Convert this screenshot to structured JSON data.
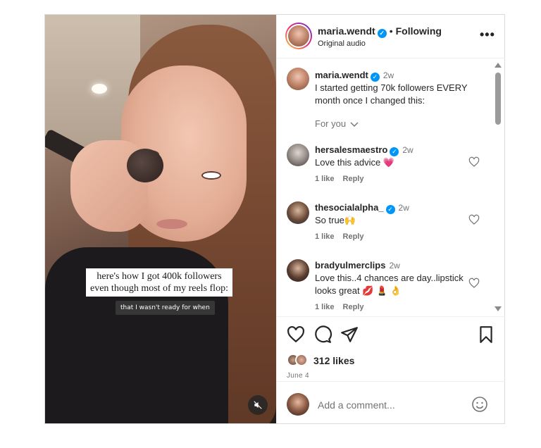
{
  "media": {
    "caption_lines": [
      "here's how I got 400k followers",
      "even though most of my reels flop:"
    ],
    "subtitle": "that I wasn't ready for when",
    "mute_icon": "mute-icon"
  },
  "header": {
    "username": "maria.wendt",
    "separator": "•",
    "follow_status": "Following",
    "audio": "Original audio",
    "more_icon": "more-options-icon"
  },
  "caption": {
    "username": "maria.wendt",
    "time": "2w",
    "text": "I started getting 70k followers EVERY month once I changed this:",
    "for_you": "For you"
  },
  "comments": [
    {
      "username": "hersalesmaestro",
      "verified": true,
      "time": "2w",
      "text": "Love this advice 💗",
      "likes": "1 like",
      "reply": "Reply"
    },
    {
      "username": "thesocialalpha_",
      "verified": true,
      "time": "2w",
      "text": "So true🙌",
      "likes": "1 like",
      "reply": "Reply"
    },
    {
      "username": "bradyulmerclips",
      "verified": false,
      "time": "2w",
      "text": "Love this..4 chances are day..lipstick looks great 💋 💄 👌",
      "likes": "1 like",
      "reply": "Reply"
    }
  ],
  "actions": {
    "icons": [
      "heart-icon",
      "comment-icon",
      "share-icon",
      "bookmark-icon"
    ],
    "likes": "312 likes",
    "date": "June 4"
  },
  "add_comment": {
    "placeholder": "Add a comment...",
    "emoji_icon": "emoji-icon"
  },
  "colors": {
    "verified_blue": "#0095f6",
    "text": "#262626",
    "muted": "#737373",
    "border": "#dbdbdb",
    "heart_emoji": "#e8488a"
  }
}
